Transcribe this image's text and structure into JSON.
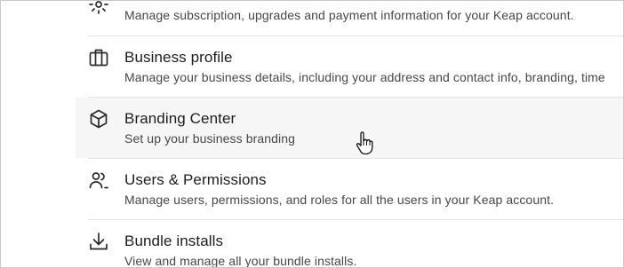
{
  "settings": {
    "items": [
      {
        "title": "",
        "description": "Manage subscription, upgrades and payment information for your Keap account.",
        "icon": "gear-icon"
      },
      {
        "title": "Business profile",
        "description": "Manage your business details, including your address and contact info, branding, time",
        "icon": "briefcase-icon"
      },
      {
        "title": "Branding Center",
        "description": "Set up your business branding",
        "icon": "cube-icon"
      },
      {
        "title": "Users & Permissions",
        "description": "Manage users, permissions, and roles for all the users in your Keap account.",
        "icon": "users-icon"
      },
      {
        "title": "Bundle installs",
        "description": "View and manage all your bundle installs.",
        "icon": "download-icon"
      }
    ]
  },
  "colors": {
    "hover_background": "#f6f6f6",
    "divider": "#e3e3e3",
    "title_text": "#1d1d1d",
    "description_text": "#474747"
  }
}
